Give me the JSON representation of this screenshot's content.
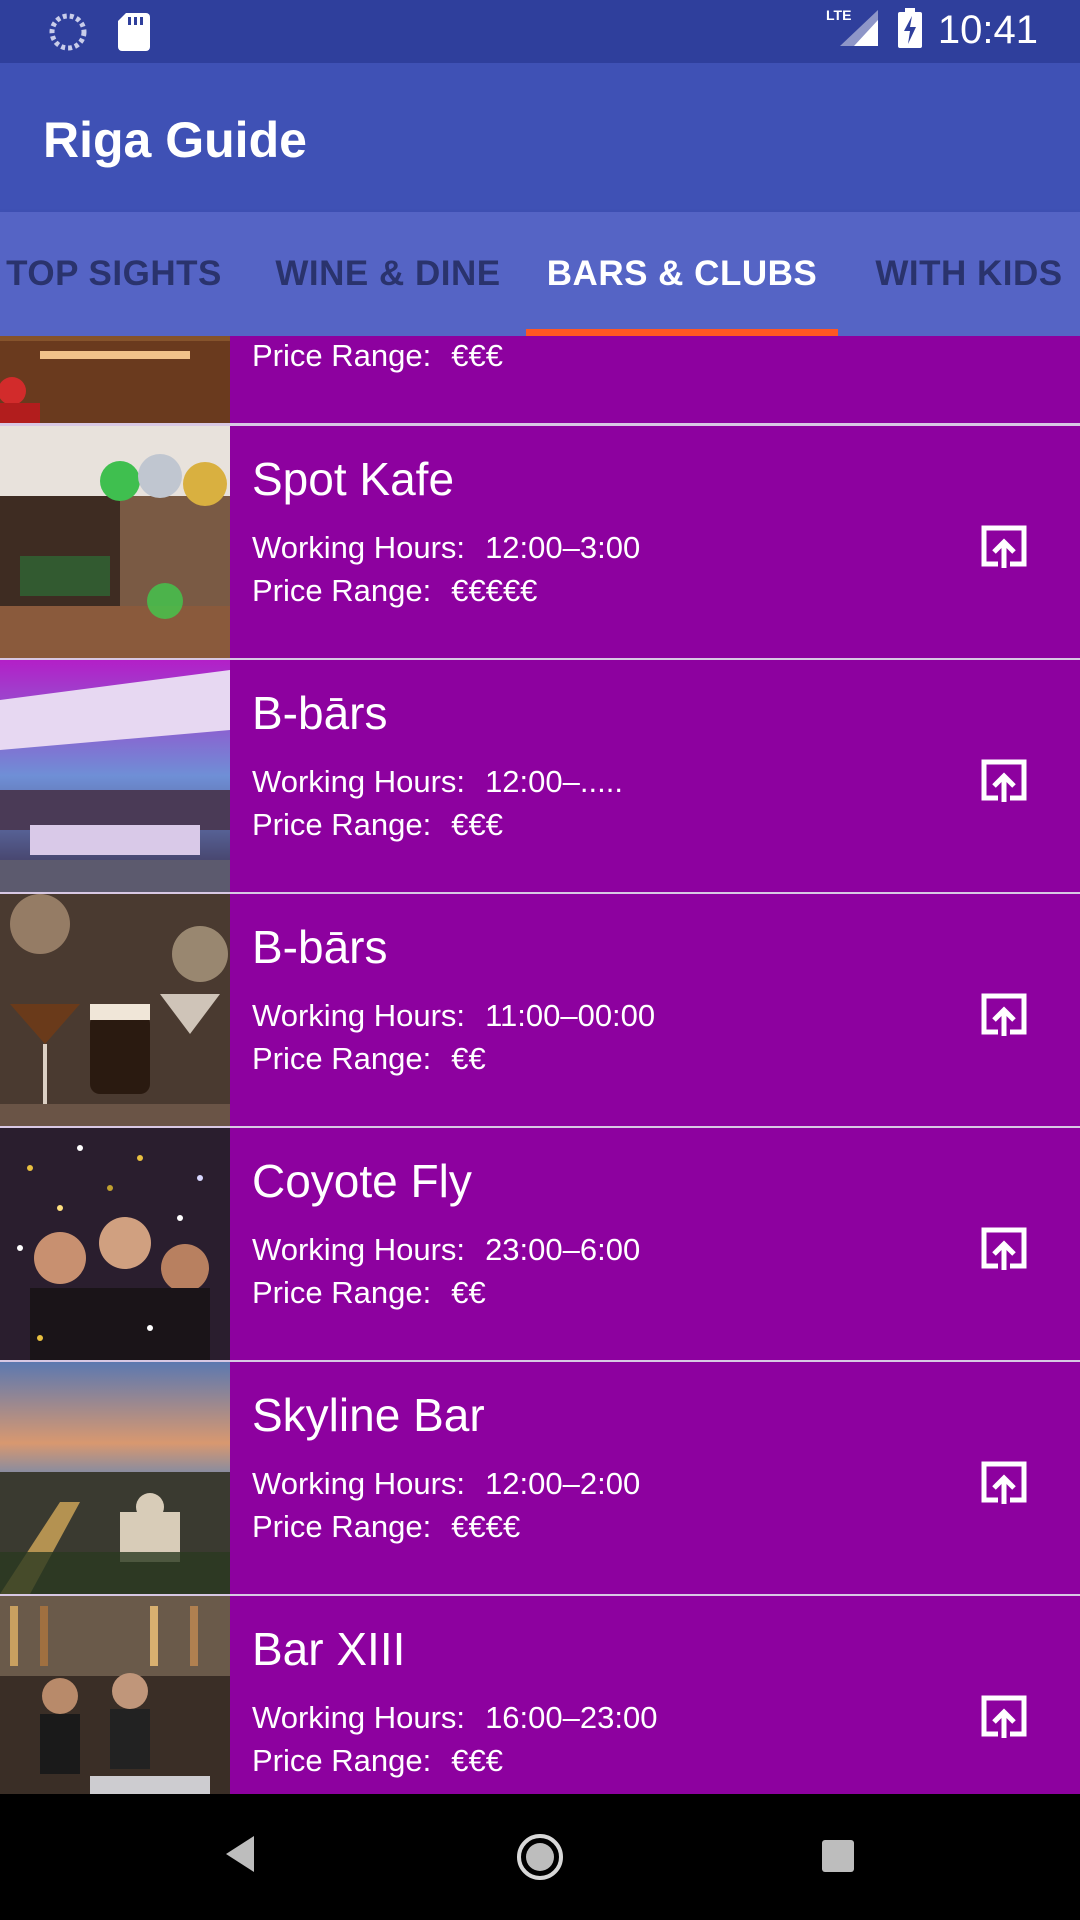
{
  "status_bar": {
    "time": "10:41",
    "network": "LTE"
  },
  "app": {
    "title": "Riga Guide"
  },
  "tabs": [
    {
      "label": "TOP SIGHTS"
    },
    {
      "label": "WINE & DINE"
    },
    {
      "label": "BARS & CLUBS",
      "active": true
    },
    {
      "label": "WITH KIDS"
    }
  ],
  "labels": {
    "hours": "Working Hours:",
    "price": "Price Range:"
  },
  "items": [
    {
      "name": "",
      "hours": "",
      "price": "€€€"
    },
    {
      "name": "Spot Kafe",
      "hours": "12:00–3:00",
      "price": "€€€€€"
    },
    {
      "name": "B-bārs",
      "hours": "12:00–.....",
      "price": "€€€"
    },
    {
      "name": "B-bārs",
      "hours": "11:00–00:00",
      "price": "€€"
    },
    {
      "name": "Coyote Fly",
      "hours": "23:00–6:00",
      "price": "€€"
    },
    {
      "name": "Skyline Bar",
      "hours": "12:00–2:00",
      "price": "€€€€"
    },
    {
      "name": "Bar XIII",
      "hours": "16:00–23:00",
      "price": "€€€"
    }
  ],
  "colors": {
    "accent": "#ff5722",
    "list_bg": "#8d019f",
    "appbar": "#3f51b5",
    "statusbar": "#2f3f9c",
    "tabs": "#5564c5"
  }
}
